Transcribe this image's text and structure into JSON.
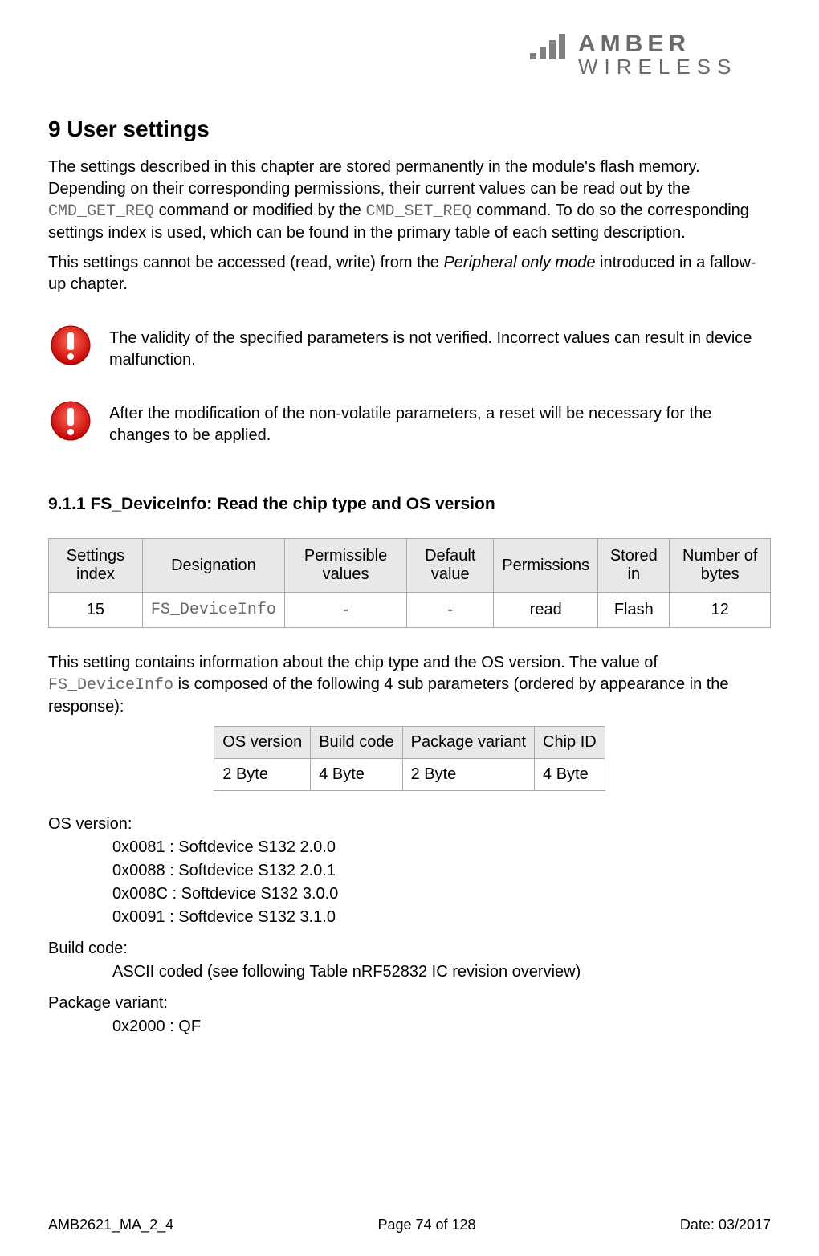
{
  "logo": {
    "line1": "AMBER",
    "line2": "WIRELESS"
  },
  "heading": "9 User settings",
  "intro": {
    "p1a": "The settings described in this chapter are stored permanently in the module's flash memory. Depending on their corresponding permissions, their current values can be read out by the ",
    "cmd1": "CMD_GET_REQ",
    "p1b": " command or modified by the ",
    "cmd2": "CMD_SET_REQ",
    "p1c": " command. To do so the corresponding settings index is used, which can be found in the primary table of each setting description.",
    "p2a": "This settings cannot be accessed (read, write) from the ",
    "p2i": "Peripheral only mode",
    "p2b": " introduced in a fallow-up chapter."
  },
  "alerts": {
    "a1": "The validity of the specified parameters is not verified. Incorrect values can result in device malfunction.",
    "a2": "After the modification of the non-volatile parameters, a reset will be necessary for the changes to be applied."
  },
  "subheading": "9.1.1 FS_DeviceInfo: Read the chip type and OS version",
  "table1": {
    "headers": {
      "c0": "Settings index",
      "c1": "Designation",
      "c2": "Permissible values",
      "c3": "Default value",
      "c4": "Permissions",
      "c5": "Stored in",
      "c6": "Number of bytes"
    },
    "row": {
      "c0": "15",
      "c1": "FS_DeviceInfo",
      "c2": "-",
      "c3": "-",
      "c4": "read",
      "c5": "Flash",
      "c6": "12"
    }
  },
  "desc": {
    "a": "This setting contains information about the chip type and the OS version. The value of ",
    "b": "FS_DeviceInfo",
    "c": " is composed of the following 4 sub parameters (ordered by appearance in the response):"
  },
  "table2": {
    "headers": {
      "c0": "OS version",
      "c1": "Build code",
      "c2": "Package variant",
      "c3": "Chip ID"
    },
    "row": {
      "c0": "2 Byte",
      "c1": "4 Byte",
      "c2": "2 Byte",
      "c3": "4 Byte"
    }
  },
  "defs": {
    "os_label": "OS version:",
    "os_vals": {
      "v0": "0x0081 : Softdevice S132 2.0.0",
      "v1": "0x0088 : Softdevice S132 2.0.1",
      "v2": "0x008C : Softdevice S132 3.0.0",
      "v3": "0x0091 : Softdevice S132 3.1.0"
    },
    "build_label": "Build code:",
    "build_val": "ASCII coded (see following Table nRF52832 IC revision overview)",
    "pkg_label": "Package variant:",
    "pkg_val": "0x2000 : QF"
  },
  "footer": {
    "left": "AMB2621_MA_2_4",
    "center": "Page 74 of 128",
    "right": "Date: 03/2017"
  }
}
